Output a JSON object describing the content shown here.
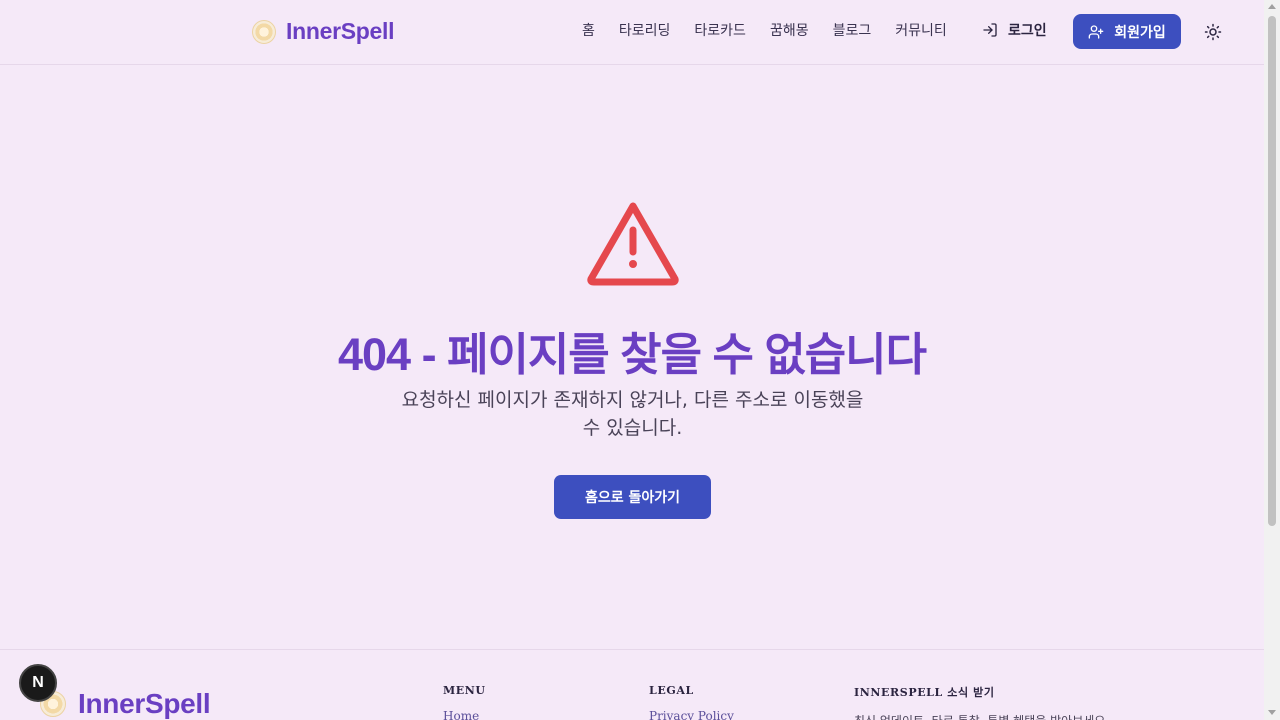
{
  "header": {
    "brand": "InnerSpell",
    "nav": [
      {
        "label": "홈"
      },
      {
        "label": "타로리딩"
      },
      {
        "label": "타로카드"
      },
      {
        "label": "꿈해몽"
      },
      {
        "label": "블로그"
      },
      {
        "label": "커뮤니티"
      }
    ],
    "login_label": "로그인",
    "signup_label": "회원가입"
  },
  "main": {
    "title": "404 - 페이지를 찾을 수 없습니다",
    "description": "요청하신 페이지가 존재하지 않거나, 다른 주소로 이동했을 수 있습니다.",
    "home_button": "홈으로 돌아가기"
  },
  "footer": {
    "brand": "InnerSpell",
    "menu_heading": "MENU",
    "menu_first": "Home",
    "legal_heading": "LEGAL",
    "legal_first": "Privacy Policy",
    "news_heading": "INNERSPELL 소식 받기",
    "news_text": "최신 업데이트, 타로 통찰, 특별 혜택을 받아보세요."
  },
  "badge": {
    "label": "N"
  },
  "colors": {
    "background": "#f5e9f8",
    "brand_purple": "#6a3fc2",
    "primary_button": "#3d4fbf",
    "warning_red": "#e5484d"
  }
}
